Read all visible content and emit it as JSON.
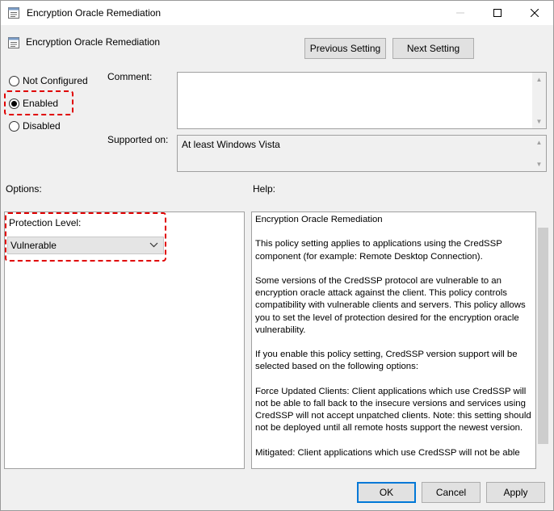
{
  "window": {
    "title": "Encryption Oracle Remediation",
    "controls": {
      "minimize_icon": "minimize-icon",
      "maximize_icon": "maximize-icon",
      "close_icon": "close-icon"
    }
  },
  "header": {
    "policy_name": "Encryption Oracle Remediation",
    "previous_setting_label": "Previous Setting",
    "next_setting_label": "Next Setting"
  },
  "state": {
    "options": [
      {
        "label": "Not Configured",
        "checked": false
      },
      {
        "label": "Enabled",
        "checked": true
      },
      {
        "label": "Disabled",
        "checked": false
      }
    ]
  },
  "comment": {
    "label": "Comment:",
    "value": ""
  },
  "supported_on": {
    "label": "Supported on:",
    "value": "At least Windows Vista"
  },
  "options_panel": {
    "label": "Options:",
    "protection_level_label": "Protection Level:",
    "protection_level_value": "Vulnerable"
  },
  "help_panel": {
    "label": "Help:",
    "paragraphs": [
      "Encryption Oracle Remediation",
      "This policy setting applies to applications using the CredSSP component (for example: Remote Desktop Connection).",
      "Some versions of the CredSSP protocol are vulnerable to an encryption oracle attack against the client.  This policy controls compatibility with vulnerable clients and servers.  This policy allows you to set the level of protection desired for the encryption oracle vulnerability.",
      "If you enable this policy setting, CredSSP version support will be selected based on the following options:",
      "Force Updated Clients: Client applications which use CredSSP will not be able to fall back to the insecure versions and services using CredSSP will not accept unpatched clients. Note: this setting should not be deployed until all remote hosts support the newest version.",
      "Mitigated: Client applications which use CredSSP will not be able"
    ]
  },
  "footer": {
    "ok_label": "OK",
    "cancel_label": "Cancel",
    "apply_label": "Apply"
  },
  "colors": {
    "highlight_dash": "#e00000",
    "default_button_border": "#0078d7"
  }
}
